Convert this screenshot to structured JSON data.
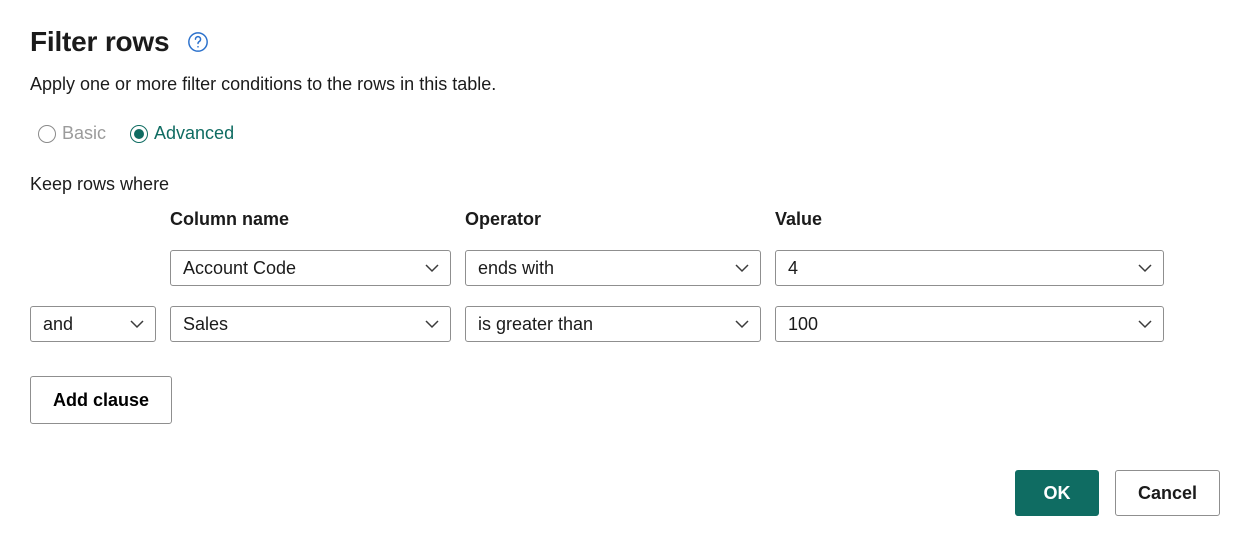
{
  "header": {
    "title": "Filter rows",
    "subtitle": "Apply one or more filter conditions to the rows in this table."
  },
  "mode": {
    "basic_label": "Basic",
    "advanced_label": "Advanced",
    "selected": "advanced"
  },
  "keep_rows_label": "Keep rows where",
  "columns": {
    "column_name_header": "Column name",
    "operator_header": "Operator",
    "value_header": "Value"
  },
  "clauses": [
    {
      "conjunction": null,
      "column": "Account Code",
      "operator": "ends with",
      "value": "4"
    },
    {
      "conjunction": "and",
      "column": "Sales",
      "operator": "is greater than",
      "value": "100"
    }
  ],
  "add_clause_label": "Add clause",
  "footer": {
    "ok_label": "OK",
    "cancel_label": "Cancel"
  }
}
